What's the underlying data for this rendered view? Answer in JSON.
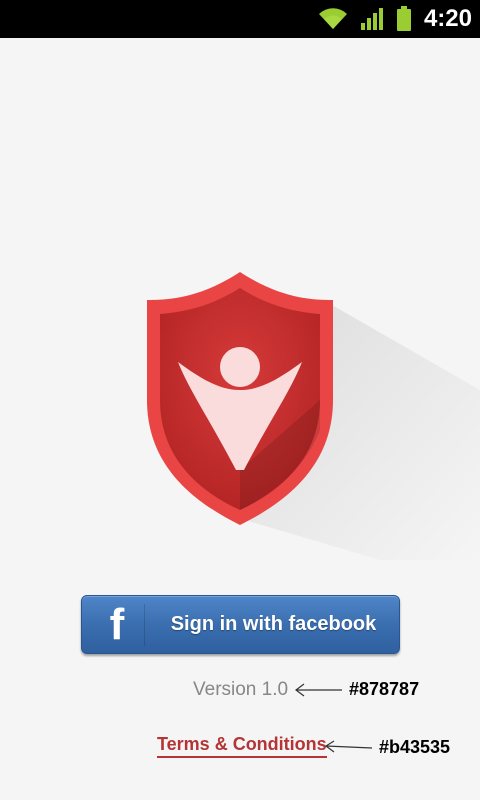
{
  "status_bar": {
    "time": "4:20",
    "icons": [
      "wifi-icon",
      "signal-icon",
      "battery-icon"
    ]
  },
  "logo": {
    "name": "shield-person-logo",
    "colors": {
      "shield": "#e53935",
      "inner": "#c62828",
      "figure": "#fbdcdc"
    }
  },
  "facebook_button": {
    "label": "Sign in with facebook",
    "icon_glyph": "f",
    "color": "#3b6fb0"
  },
  "version": {
    "text": "Version 1.0",
    "color": "#878787"
  },
  "terms": {
    "text": "Terms & Conditions",
    "color": "#b43535"
  },
  "annotations": {
    "version_color": "#878787",
    "terms_color": "#b43535"
  }
}
